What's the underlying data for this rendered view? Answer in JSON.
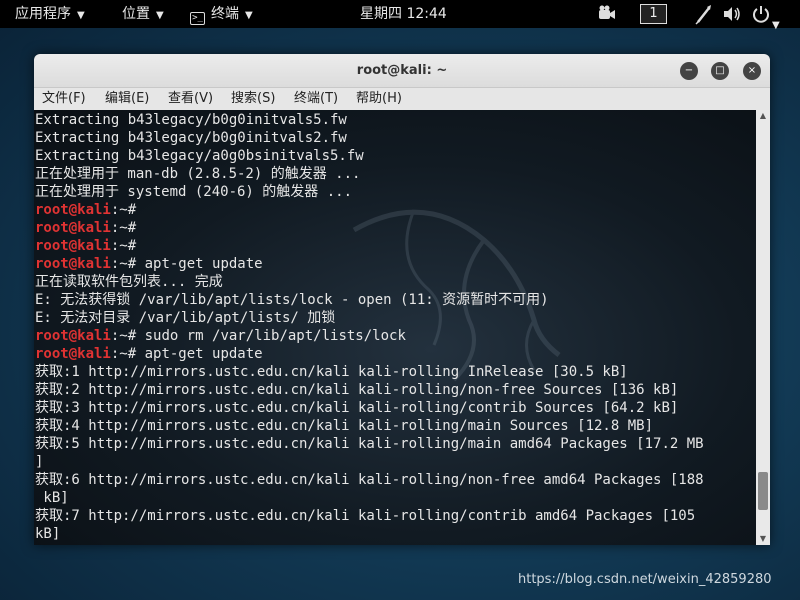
{
  "topbar": {
    "apps_label": "应用程序",
    "places_label": "位置",
    "terminal_label": "终端",
    "terminal_icon_glyph": ">_",
    "clock": "星期四 12:44",
    "workspace": "1"
  },
  "window": {
    "title": "root@kali: ~",
    "minimize_glyph": "−",
    "maximize_glyph": "□",
    "close_glyph": "×"
  },
  "menu": [
    "文件(F)",
    "编辑(E)",
    "查看(V)",
    "搜索(S)",
    "终端(T)",
    "帮助(H)"
  ],
  "terminal": {
    "prompt_user": "root@kali",
    "prompt_path": ":~#",
    "lines": [
      {
        "text": "Extracting b43legacy/b0g0initvals5.fw"
      },
      {
        "text": "Extracting b43legacy/b0g0initvals2.fw"
      },
      {
        "text": "Extracting b43legacy/a0g0bsinitvals5.fw"
      },
      {
        "text": "正在处理用于 man-db (2.8.5-2) 的触发器 ..."
      },
      {
        "text": "正在处理用于 systemd (240-6) 的触发器 ..."
      },
      {
        "prompt": true,
        "text": ""
      },
      {
        "prompt": true,
        "text": ""
      },
      {
        "prompt": true,
        "text": ""
      },
      {
        "prompt": true,
        "text": " apt-get update"
      },
      {
        "text": "正在读取软件包列表... 完成"
      },
      {
        "text": "E: 无法获得锁 /var/lib/apt/lists/lock - open (11: 资源暂时不可用)"
      },
      {
        "text": "E: 无法对目录 /var/lib/apt/lists/ 加锁"
      },
      {
        "prompt": true,
        "text": " sudo rm /var/lib/apt/lists/lock"
      },
      {
        "prompt": true,
        "text": " apt-get update"
      },
      {
        "text": "获取:1 http://mirrors.ustc.edu.cn/kali kali-rolling InRelease [30.5 kB]"
      },
      {
        "text": "获取:2 http://mirrors.ustc.edu.cn/kali kali-rolling/non-free Sources [136 kB]"
      },
      {
        "text": "获取:3 http://mirrors.ustc.edu.cn/kali kali-rolling/contrib Sources [64.2 kB]"
      },
      {
        "text": "获取:4 http://mirrors.ustc.edu.cn/kali kali-rolling/main Sources [12.8 MB]"
      },
      {
        "text": "获取:5 http://mirrors.ustc.edu.cn/kali kali-rolling/main amd64 Packages [17.2 MB"
      },
      {
        "text": "]"
      },
      {
        "text": "获取:6 http://mirrors.ustc.edu.cn/kali kali-rolling/non-free amd64 Packages [188"
      },
      {
        "text": " kB]"
      },
      {
        "text": "获取:7 http://mirrors.ustc.edu.cn/kali kali-rolling/contrib amd64 Packages [105"
      },
      {
        "text": "kB]"
      }
    ]
  },
  "watermark": "https://blog.csdn.net/weixin_42859280"
}
